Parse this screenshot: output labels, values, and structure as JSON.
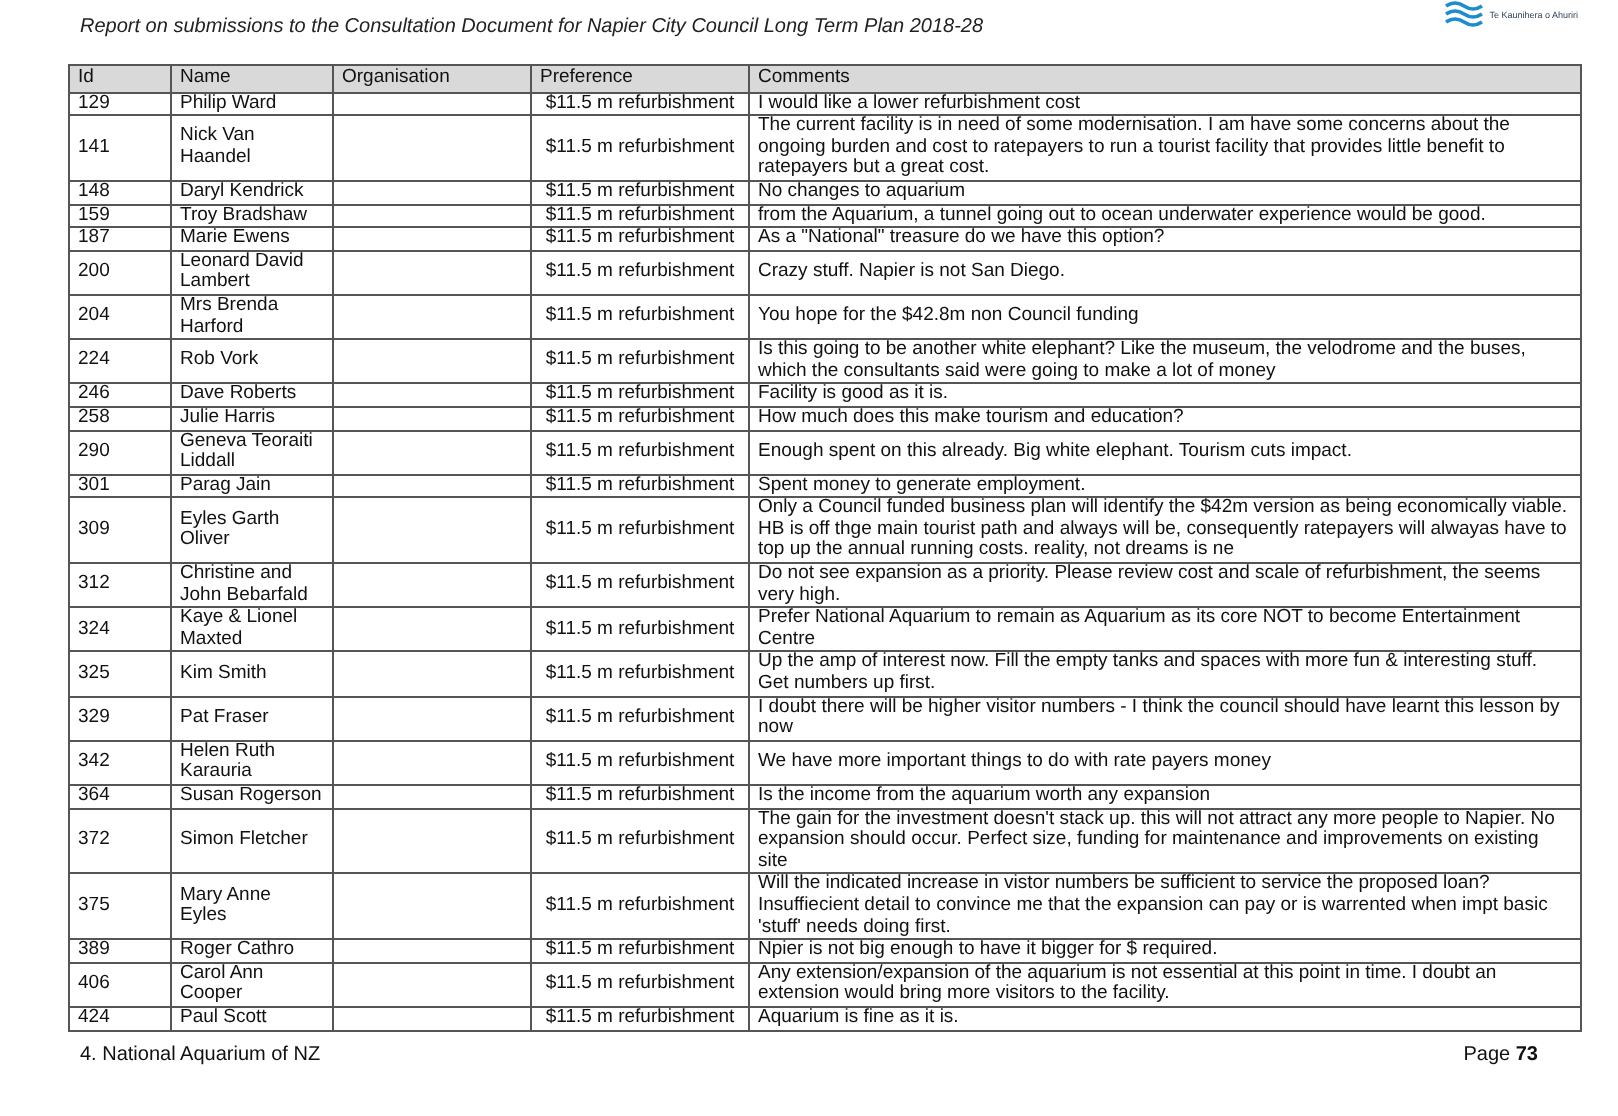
{
  "header": {
    "title": "Report on submissions to the Consultation Document for Napier City Council Long Term Plan 2018-28",
    "logo_text": "Te Kaunihera o Ahuriri"
  },
  "table": {
    "columns": [
      "Id",
      "Name",
      "Organisation",
      "Preference",
      "Comments"
    ],
    "rows": [
      {
        "id": "129",
        "name": "Philip Ward",
        "organisation": "",
        "preference": "$11.5 m refurbishment",
        "comments": "I would like a lower refurbishment cost"
      },
      {
        "id": "141",
        "name": "Nick Van\nHaandel",
        "organisation": "",
        "preference": "$11.5 m refurbishment",
        "comments": "The current facility is in need of some modernisation. I am have some concerns about the ongoing burden and cost to ratepayers to run a tourist facility that provides little benefit to ratepayers but a great cost."
      },
      {
        "id": "148",
        "name": "Daryl Kendrick",
        "organisation": "",
        "preference": "$11.5 m refurbishment",
        "comments": "No changes to aquarium"
      },
      {
        "id": "159",
        "name": "Troy Bradshaw",
        "organisation": "",
        "preference": "$11.5 m refurbishment",
        "comments": "from the Aquarium, a tunnel going out to ocean underwater experience would be good."
      },
      {
        "id": "187",
        "name": "Marie Ewens",
        "organisation": "",
        "preference": "$11.5 m refurbishment",
        "comments": "As a \"National\" treasure do we have this option?"
      },
      {
        "id": "200",
        "name": "Leonard David\nLambert",
        "organisation": "",
        "preference": "$11.5 m refurbishment",
        "comments": "Crazy stuff. Napier is not San Diego."
      },
      {
        "id": "204",
        "name": "Mrs Brenda\nHarford",
        "organisation": "",
        "preference": "$11.5 m refurbishment",
        "comments": "You hope for the $42.8m non Council funding"
      },
      {
        "id": "224",
        "name": "Rob Vork",
        "organisation": "",
        "preference": "$11.5 m refurbishment",
        "comments": "Is this going to be another white elephant? Like the museum, the velodrome and the buses, which the consultants said were going to make a lot of money"
      },
      {
        "id": "246",
        "name": "Dave Roberts",
        "organisation": "",
        "preference": "$11.5 m refurbishment",
        "comments": "Facility is good as it is."
      },
      {
        "id": "258",
        "name": "Julie Harris",
        "organisation": "",
        "preference": "$11.5 m refurbishment",
        "comments": "How much does this make tourism and education?"
      },
      {
        "id": "290",
        "name": "Geneva Teoraiti\nLiddall",
        "organisation": "",
        "preference": "$11.5 m refurbishment",
        "comments": "Enough spent on this already. Big white elephant. Tourism cuts impact."
      },
      {
        "id": "301",
        "name": "Parag Jain",
        "organisation": "",
        "preference": "$11.5 m refurbishment",
        "comments": "Spent money to generate employment."
      },
      {
        "id": "309",
        "name": "Eyles Garth\nOliver",
        "organisation": "",
        "preference": "$11.5 m refurbishment",
        "comments": "Only a Council funded business plan will identify the $42m version as being economically viable. HB is off thge main tourist path and always will be, consequently ratepayers will alwayas have to top up the annual running costs. reality, not dreams  is ne"
      },
      {
        "id": "312",
        "name": "Christine and\nJohn Bebarfald",
        "organisation": "",
        "preference": "$11.5 m refurbishment",
        "comments": "Do not see expansion as a priority.  Please review cost and scale of refurbishment, the seems very high."
      },
      {
        "id": "324",
        "name": "Kaye & Lionel\nMaxted",
        "organisation": "",
        "preference": "$11.5 m refurbishment",
        "comments": "Prefer National Aquarium to remain as Aquarium as its core NOT to become Entertainment Centre"
      },
      {
        "id": "325",
        "name": "Kim Smith",
        "organisation": "",
        "preference": "$11.5 m refurbishment",
        "comments": "Up the amp of interest now. Fill the empty tanks and spaces with more fun & interesting stuff. Get numbers up first."
      },
      {
        "id": "329",
        "name": "Pat Fraser",
        "organisation": "",
        "preference": "$11.5 m refurbishment",
        "comments": "I doubt there will be higher visitor numbers - I think the council should have learnt this lesson by now"
      },
      {
        "id": "342",
        "name": "Helen Ruth\nKarauria",
        "organisation": "",
        "preference": "$11.5 m refurbishment",
        "comments": "We have more important things to do with rate payers money"
      },
      {
        "id": "364",
        "name": "Susan Rogerson",
        "organisation": "",
        "preference": "$11.5 m refurbishment",
        "comments": "Is the income from the aquarium worth any expansion"
      },
      {
        "id": "372",
        "name": "Simon Fletcher",
        "organisation": "",
        "preference": "$11.5 m refurbishment",
        "comments": "The gain for the investment doesn't stack up.  this will not attract any more people to Napier.  No expansion should occur.  Perfect size, funding for maintenance and improvements on existing site"
      },
      {
        "id": "375",
        "name": "Mary Anne\nEyles",
        "organisation": "",
        "preference": "$11.5 m refurbishment",
        "comments": "Will the indicated increase in vistor numbers be sufficient to service the proposed loan? Insuffiecient detail to convince me that the expansion can pay or is warrented when impt basic 'stuff' needs doing first."
      },
      {
        "id": "389",
        "name": "Roger Cathro",
        "organisation": "",
        "preference": "$11.5 m refurbishment",
        "comments": "Npier is not big enough to have it bigger for $ required."
      },
      {
        "id": "406",
        "name": "Carol Ann\nCooper",
        "organisation": "",
        "preference": "$11.5 m refurbishment",
        "comments": "Any extension/expansion of the aquarium is not essential at this point in time.  I doubt an extension would bring more visitors to the facility."
      },
      {
        "id": "424",
        "name": "Paul Scott",
        "organisation": "",
        "preference": "$11.5 m refurbishment",
        "comments": "Aquarium is fine as it is."
      }
    ]
  },
  "footer": {
    "section": "4. National Aquarium of NZ",
    "page": "Page **73**"
  }
}
